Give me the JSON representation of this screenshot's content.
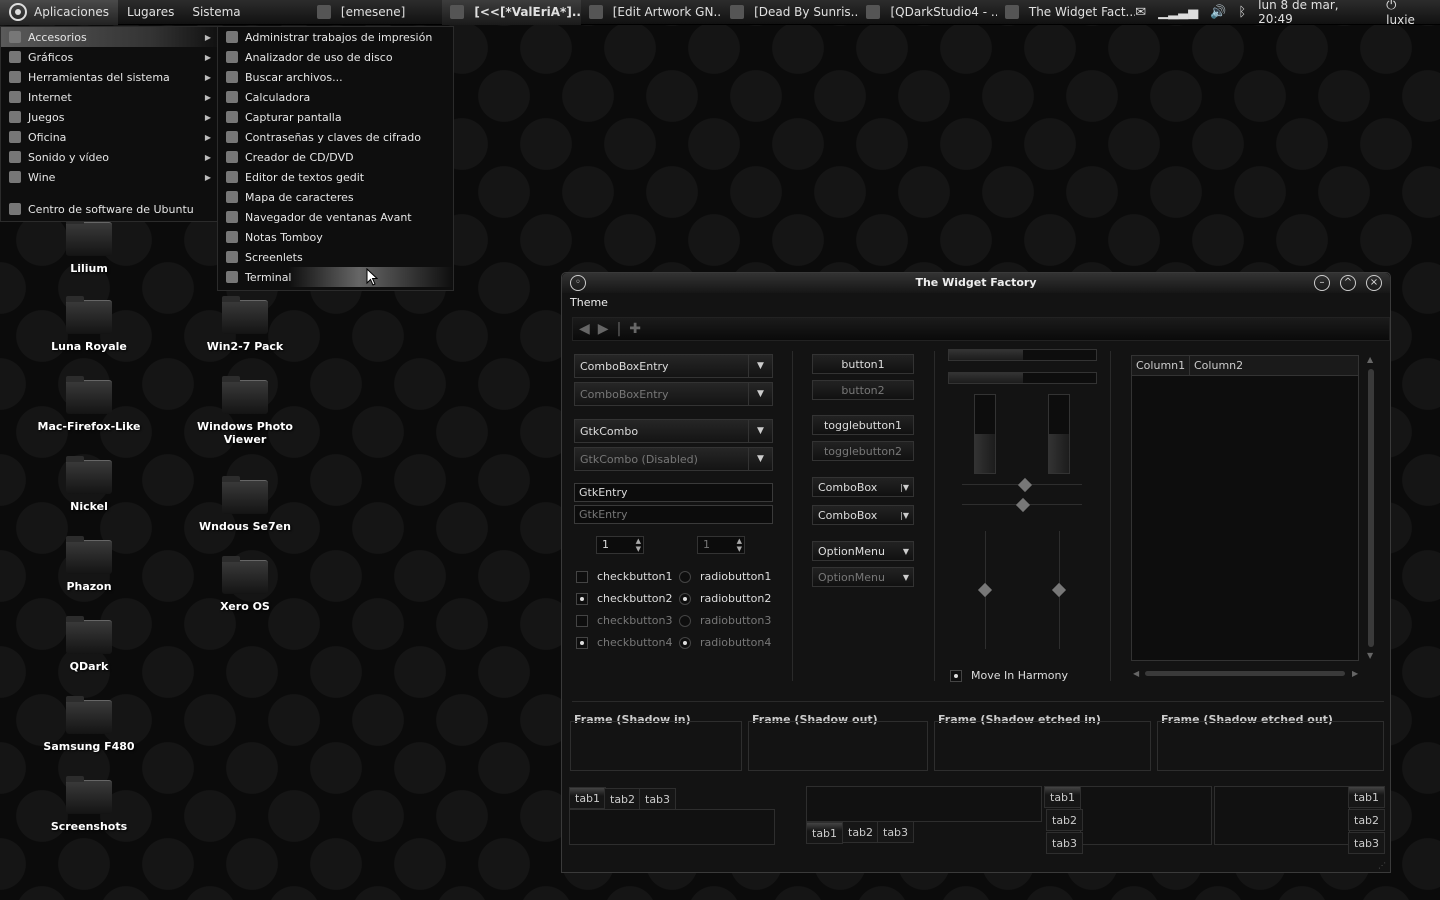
{
  "panel": {
    "menus": [
      "Aplicaciones",
      "Lugares",
      "Sistema"
    ],
    "tasks": [
      "[emesene]",
      "[<<[*ValEriA*]...",
      "[Edit Artwork GN...",
      "[Dead By Sunris...",
      "[QDarkStudio4 - ...",
      "The Widget Fact..."
    ],
    "clock": "lun  8 de mar, 20:49",
    "user": "luxie"
  },
  "menu": {
    "categories": [
      "Accesorios",
      "Gráficos",
      "Herramientas del sistema",
      "Internet",
      "Juegos",
      "Oficina",
      "Sonido y vídeo",
      "Wine"
    ],
    "software_center": "Centro de software de Ubuntu",
    "accessories": [
      "Administrar trabajos de impresión",
      "Analizador de uso de disco",
      "Buscar archivos...",
      "Calculadora",
      "Capturar pantalla",
      "Contraseñas y claves de cifrado",
      "Creador de CD/DVD",
      "Editor de textos gedit",
      "Mapa de caracteres",
      "Navegador de ventanas Avant",
      "Notas Tomboy",
      "Screenlets",
      "Terminal"
    ]
  },
  "desktop": {
    "col1": [
      "Lilium",
      "Luna Royale",
      "Mac-Firefox-Like",
      "Nickel",
      "Phazon",
      "QDark",
      "Samsung F480",
      "Screenshots"
    ],
    "col2": [
      "Win2-7 Pack",
      "Windows Photo Viewer",
      "Wndous Se7en",
      "Xero OS"
    ]
  },
  "window": {
    "title": "The Widget Factory",
    "menu": "Theme",
    "combos": [
      "ComboBoxEntry",
      "ComboBoxEntry",
      "GtkCombo",
      "GtkCombo (Disabled)"
    ],
    "entries": [
      "GtkEntry",
      "GtkEntry"
    ],
    "spins": [
      "1",
      "1"
    ],
    "checks": [
      "checkbutton1",
      "checkbutton2",
      "checkbutton3",
      "checkbutton4"
    ],
    "radios": [
      "radiobutton1",
      "radiobutton2",
      "radiobutton3",
      "radiobutton4"
    ],
    "buttons": [
      "button1",
      "button2",
      "togglebutton1",
      "togglebutton2"
    ],
    "combobox": [
      "ComboBox",
      "ComboBox"
    ],
    "option": [
      "OptionMenu",
      "OptionMenu"
    ],
    "harmony": "Move In Harmony",
    "columns": [
      "Column1",
      "Column2"
    ],
    "frames": [
      "Frame (Shadow in)",
      "Frame (Shadow out)",
      "Frame (Shadow etched in)",
      "Frame (Shadow etched out)"
    ],
    "tabs": [
      "tab1",
      "tab2",
      "tab3"
    ],
    "progress": {
      "h1": 0.5,
      "h2": 0.5,
      "v1": 0.5,
      "v2": 0.5
    }
  }
}
